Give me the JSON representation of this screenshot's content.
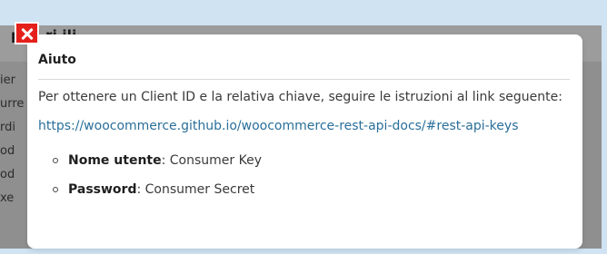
{
  "background": {
    "title_fragment": "p  di   ri ili",
    "left_fragments": [
      "ier",
      "urre",
      "rdi",
      "od",
      "od",
      "xe"
    ]
  },
  "modal": {
    "title": "Aiuto",
    "intro": "Per ottenere un Client ID e la relativa chiave, seguire le istruzioni al link seguente:",
    "link": "https://woocommerce.github.io/woocommerce-rest-api-docs/#rest-api-keys",
    "items": [
      {
        "label": "Nome utente",
        "separator": ": ",
        "value": "Consumer Key"
      },
      {
        "label": "Password",
        "separator": ": ",
        "value": "Consumer Secret"
      }
    ]
  },
  "close": {
    "icon": "close-icon",
    "color": "#e5201b"
  }
}
